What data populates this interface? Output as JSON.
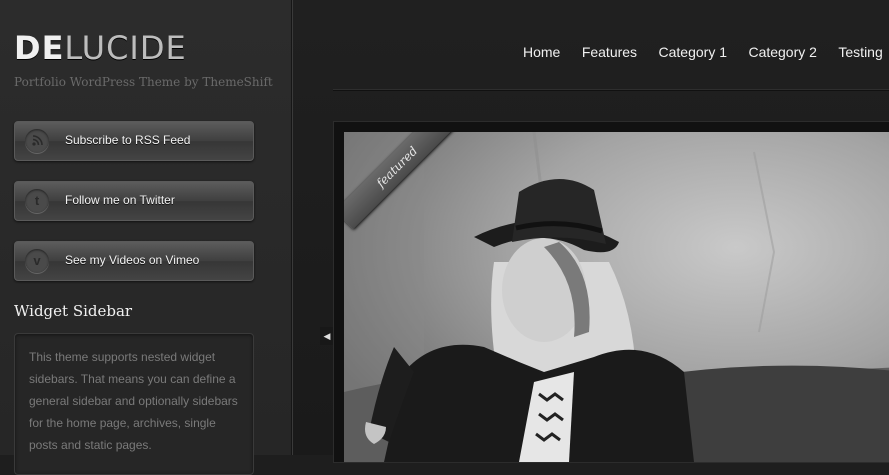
{
  "logo": {
    "part1": "DE",
    "part2": "LUCIDE"
  },
  "tagline": "Portfolio WordPress Theme by ThemeShift",
  "social": [
    {
      "label": "Subscribe to RSS Feed",
      "icon": "rss-icon",
      "glyph": ""
    },
    {
      "label": "Follow me on Twitter",
      "icon": "twitter-icon",
      "glyph": "t"
    },
    {
      "label": "See my Videos on Vimeo",
      "icon": "vimeo-icon",
      "glyph": "v"
    }
  ],
  "widget": {
    "title": "Widget Sidebar",
    "text": "This theme supports nested widget sidebars. That means you can define a general sidebar and optionally sidebars for the home page, archives, single posts and static pages."
  },
  "nav": {
    "items": [
      "Home",
      "Features",
      "Category 1",
      "Category 2",
      "Testing"
    ]
  },
  "slider": {
    "ribbon_label": "featured",
    "arrow_icon": "chevron-left-icon"
  }
}
